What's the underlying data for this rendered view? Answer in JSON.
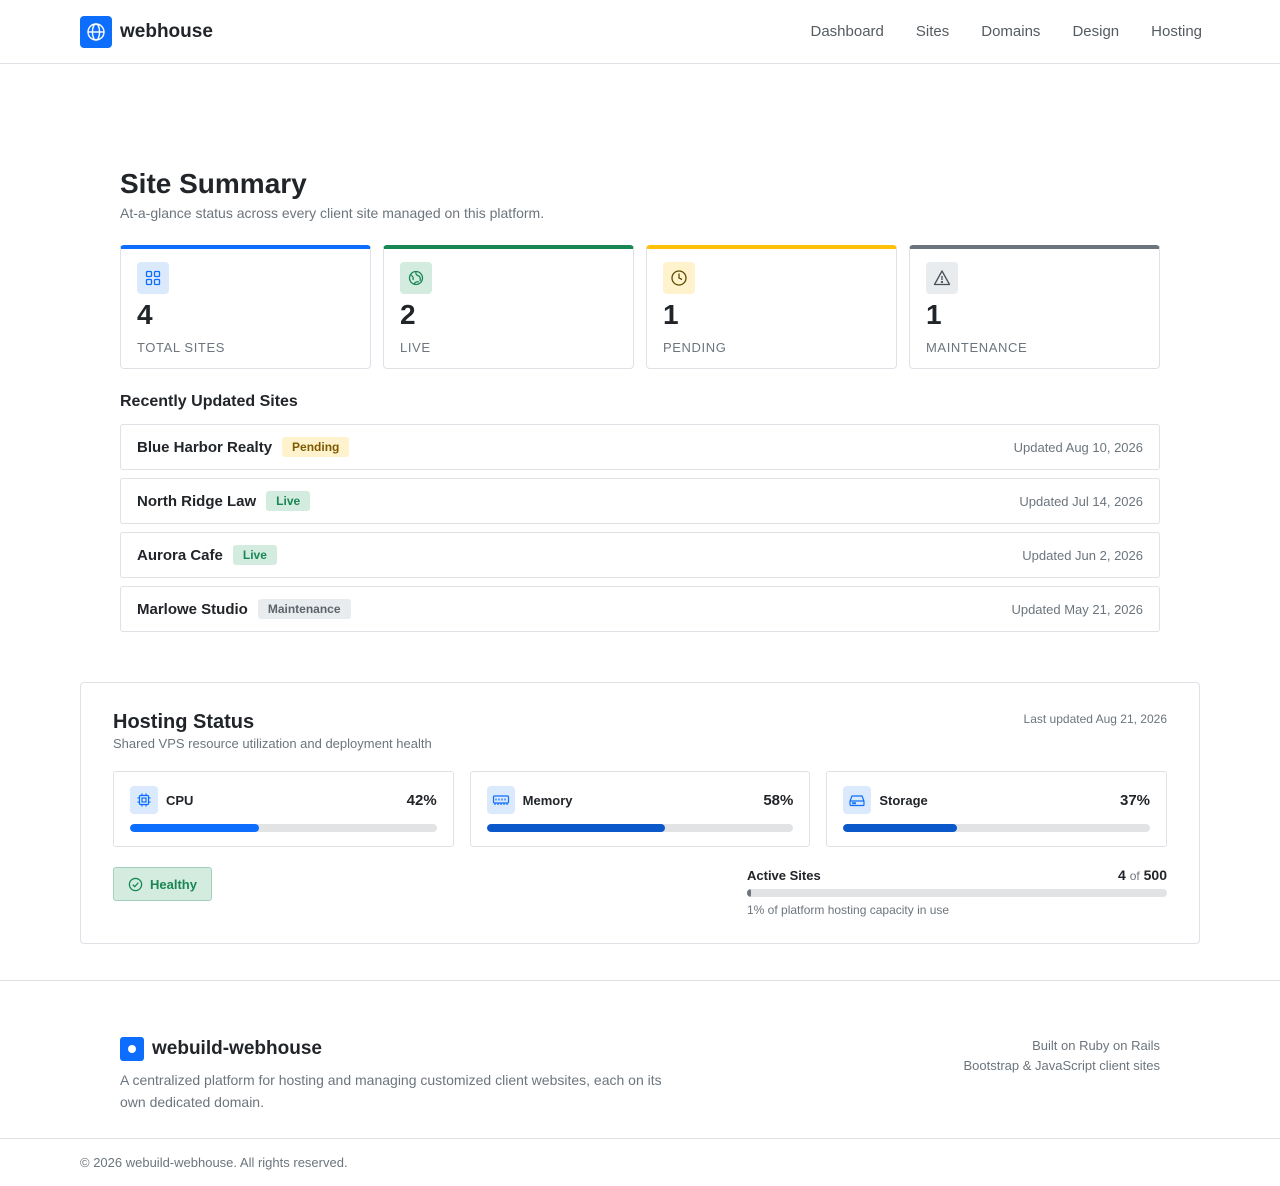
{
  "header": {
    "brand": "webhouse",
    "logo_icon": "globe-icon",
    "nav": [
      "Dashboard",
      "Sites",
      "Domains",
      "Design",
      "Hosting"
    ]
  },
  "summary": {
    "title": "Site Summary",
    "subtitle": "At-a-glance status across every client site managed on this platform.",
    "stats": [
      {
        "value": "4",
        "label": "TOTAL SITES",
        "icon": "grid-icon",
        "accent": "#0d6efd"
      },
      {
        "value": "2",
        "label": "LIVE",
        "icon": "globe-icon",
        "accent": "#198754"
      },
      {
        "value": "1",
        "label": "PENDING",
        "icon": "clock-icon",
        "accent": "#ffc107"
      },
      {
        "value": "1",
        "label": "MAINTENANCE",
        "icon": "warning-icon",
        "accent": "#6c757d"
      }
    ],
    "recent_title": "Recently Updated Sites",
    "recent": [
      {
        "name": "Blue Harbor Realty",
        "status": "Pending",
        "updated": "Updated Aug 10, 2026"
      },
      {
        "name": "North Ridge Law",
        "status": "Live",
        "updated": "Updated Jul 14, 2026"
      },
      {
        "name": "Aurora Cafe",
        "status": "Live",
        "updated": "Updated Jun 2, 2026"
      },
      {
        "name": "Marlowe Studio",
        "status": "Maintenance",
        "updated": "Updated May 21, 2026"
      }
    ]
  },
  "hosting": {
    "title": "Hosting Status",
    "subtitle": "Shared VPS resource utilization and deployment health",
    "last_updated": "Last updated Aug 21, 2026",
    "metrics": [
      {
        "name": "CPU",
        "percent": "42%",
        "fill": 0.42,
        "icon": "cpu-icon",
        "color": "#0d6efd"
      },
      {
        "name": "Memory",
        "percent": "58%",
        "fill": 0.58,
        "icon": "memory-icon",
        "color": "#0a58ca"
      },
      {
        "name": "Storage",
        "percent": "37%",
        "fill": 0.37,
        "icon": "storage-icon",
        "color": "#0a58ca"
      }
    ],
    "health": "Healthy",
    "active_label": "Active Sites",
    "active_count": "4",
    "active_of": "of",
    "active_total": "500",
    "active_fill": 0.01,
    "active_note": "1% of platform hosting capacity in use"
  },
  "footer": {
    "brand": "webuild-webhouse",
    "description": "A centralized platform for hosting and managing customized client websites, each on its own dedicated domain.",
    "right_lines": [
      "Built on Ruby on Rails",
      "Bootstrap & JavaScript client sites"
    ],
    "copyright": "© 2026 webuild-webhouse. All rights reserved."
  }
}
